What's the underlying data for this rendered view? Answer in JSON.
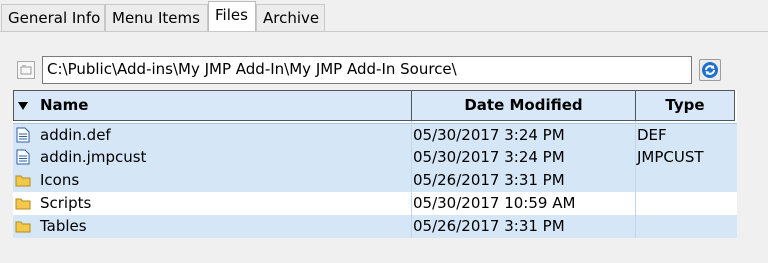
{
  "tabs": [
    {
      "label": "General Info",
      "active": false
    },
    {
      "label": "Menu Items",
      "active": false
    },
    {
      "label": "Files",
      "active": true
    },
    {
      "label": "Archive",
      "active": false
    }
  ],
  "path": {
    "value": "C:\\Public\\Add-ins\\My JMP Add-In\\My JMP Add-In Source\\",
    "icon": "folder-path-icon",
    "refresh_icon": "refresh-icon"
  },
  "table": {
    "columns": [
      "Name",
      "Date Modified",
      "Type"
    ],
    "sort_column": "Name",
    "rows": [
      {
        "name": "addin.def",
        "date": "05/30/2017 3:24 PM",
        "type": "DEF",
        "icon": "document-icon"
      },
      {
        "name": "addin.jmpcust",
        "date": "05/30/2017 3:24 PM",
        "type": "JMPCUST",
        "icon": "document-icon"
      },
      {
        "name": "Icons",
        "date": "05/26/2017 3:31 PM",
        "type": "",
        "icon": "folder-icon"
      },
      {
        "name": "Scripts",
        "date": "05/30/2017 10:59 AM",
        "type": "",
        "icon": "folder-icon"
      },
      {
        "name": "Tables",
        "date": "05/26/2017 3:31 PM",
        "type": "",
        "icon": "folder-icon"
      }
    ]
  },
  "colors": {
    "header_bg": "#d9e8f8",
    "row_highlight": "#d5e6f7",
    "folder": "#f2c94c",
    "refresh": "#1f6fd1"
  }
}
